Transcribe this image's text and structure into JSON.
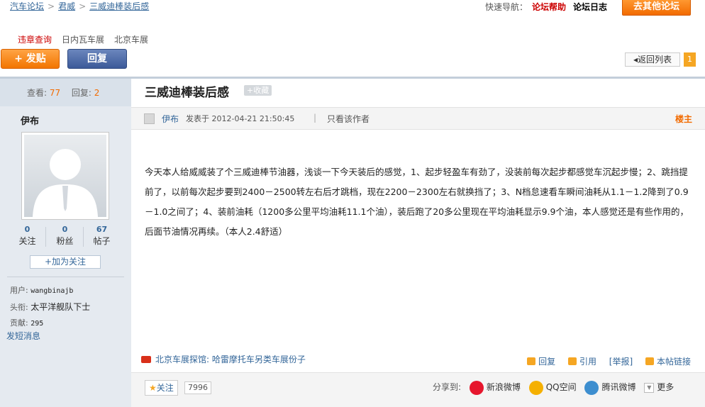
{
  "breadcrumb": {
    "items": [
      "汽车论坛",
      "君威",
      "三威迪棒装后感"
    ],
    "separator": ">"
  },
  "quicknav": {
    "label": "快速导航：",
    "help": "论坛帮助",
    "log": "论坛日志",
    "other_forum": "去其他论坛"
  },
  "links": [
    "违章查询",
    "日内瓦车展",
    "北京车展"
  ],
  "actions": {
    "post": "+ 发贴",
    "reply": "回复",
    "back": "◂返回列表",
    "page": "1"
  },
  "sidebar": {
    "views_label": "查看:",
    "views": "77",
    "replies_label": "回复:",
    "replies": "2",
    "author": "伊布",
    "counts": [
      {
        "num": "0",
        "label": "关注"
      },
      {
        "num": "0",
        "label": "粉丝"
      },
      {
        "num": "67",
        "label": "帖子"
      }
    ],
    "follow": "+加为关注",
    "profile": {
      "user_label": "用户:",
      "user": "wangbinajb",
      "title_label": "头衔:",
      "title": "太平洋舰队下士",
      "contrib_label": "贡献:",
      "contrib": "295"
    },
    "pm": "发短消息"
  },
  "post": {
    "title": "三威迪棒装后感",
    "fav": "+收藏",
    "author": "伊布",
    "posted": "发表于 2012-04-21 21:50:45",
    "divider": "|",
    "only_author": "只看该作者",
    "floor": "楼主",
    "content": "今天本人给威威装了个三威迪棒节油器，浅谈一下今天装后的感觉，1、起步轻盈车有劲了，没装前每次起步都感觉车沉起步慢；2、跳挡提前了，以前每次起步要到2400－2500转左右后才跳档，现在2200－2300左右就换挡了；3、N档怠速看车瞬间油耗从1.1－1.2降到了0.9－1.0之间了；4、装前油耗（1200多公里平均油耗11.1个油），装后跑了20多公里现在平均油耗显示9.9个油，本人感觉还是有些作用的，后面节油情况再续。（本人2.4舒适）"
  },
  "footer": {
    "ad_prefix": "北京车展探馆:",
    "ad_text": "哈雷摩托车另类车展份子",
    "ops": [
      "回复",
      "引用",
      "[举报]",
      "本帖链接"
    ],
    "watch": "关注",
    "watch_count": "7996",
    "share_label": "分享到:",
    "share": [
      {
        "name": "新浪微博",
        "color": "#e6162d"
      },
      {
        "name": "QQ空间",
        "color": "#f5b000"
      },
      {
        "name": "腾讯微博",
        "color": "#3d8ecf"
      }
    ],
    "more": "更多"
  }
}
